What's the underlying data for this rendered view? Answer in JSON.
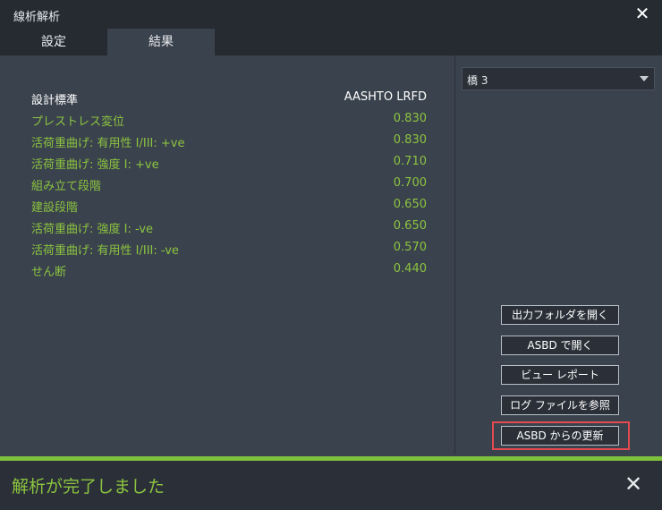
{
  "window": {
    "title": "線析解析",
    "close_icon": "close-icon"
  },
  "tabs": [
    {
      "label": "設定",
      "active": false
    },
    {
      "label": "結果",
      "active": true
    }
  ],
  "results": {
    "header": {
      "label": "設計標準",
      "value": "AASHTO LRFD"
    },
    "rows": [
      {
        "label": "プレストレス変位",
        "value": "0.830"
      },
      {
        "label": "活荷重曲げ: 有用性 I/III: +ve",
        "value": "0.830"
      },
      {
        "label": "活荷重曲げ: 強度 I: +ve",
        "value": "0.710"
      },
      {
        "label": "組み立て段階",
        "value": "0.700"
      },
      {
        "label": "建設段階",
        "value": "0.650"
      },
      {
        "label": "活荷重曲げ: 強度 I: -ve",
        "value": "0.650"
      },
      {
        "label": "活荷重曲げ: 有用性 I/III: -ve",
        "value": "0.570"
      },
      {
        "label": "せん断",
        "value": "0.440"
      }
    ]
  },
  "bridge_select": {
    "value": "橋 3"
  },
  "buttons": {
    "open_output": "出力フォルダを開く",
    "open_asbd": "ASBD で開く",
    "view_report": "ビュー レポート",
    "view_log": "ログ ファイルを参照",
    "update_from_asbd": "ASBD からの更新"
  },
  "status": {
    "message": "解析が完了しました",
    "progress": 1.0
  },
  "colors": {
    "accent_green": "#8cc43f",
    "progress_green": "#7ec13d",
    "highlight_red": "#e34a4f",
    "panel_bg": "#3a424d",
    "dark_bg": "#2b3038"
  }
}
